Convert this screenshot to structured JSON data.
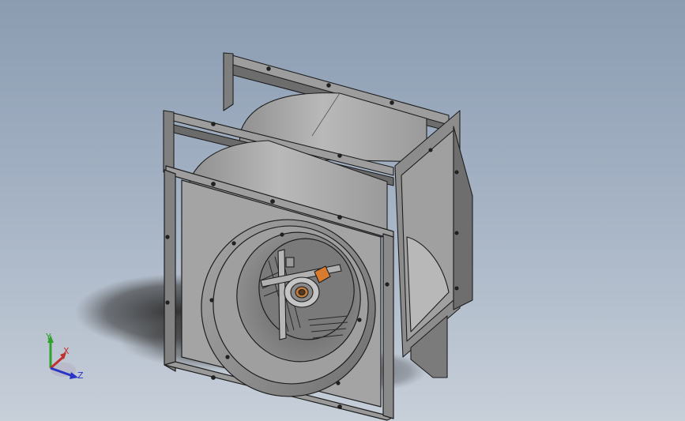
{
  "viewport": {
    "background_top": "#8b9cb1",
    "background_bottom": "#c7cfd9",
    "model": "centrifugal-fan-assembly"
  },
  "triad": {
    "y_label": "Y",
    "x_label": "X",
    "z_label": "Z",
    "y_color": "#2fa12f",
    "x_color": "#c0302c",
    "z_color": "#2a35c8"
  },
  "colors": {
    "frame_face": "#7e7e7e",
    "frame_edge": "#9d9d9d",
    "housing": "#a8a8a8",
    "bearing_accent": "#d97b2e",
    "edge_line": "#1e1e1e"
  }
}
